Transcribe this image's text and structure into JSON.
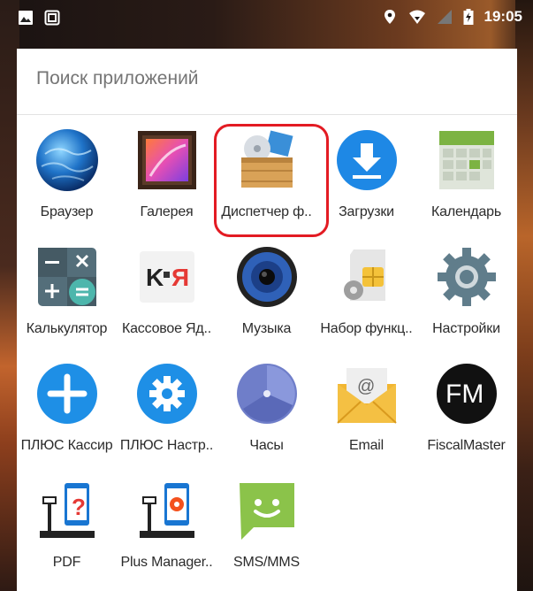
{
  "status_bar": {
    "time": "19:05",
    "left_icons": [
      "image-icon",
      "screenshot-icon"
    ],
    "right_icons": [
      "location-icon",
      "wifi-icon",
      "signal-icon",
      "battery-icon"
    ]
  },
  "search": {
    "placeholder": "Поиск приложений"
  },
  "apps": [
    [
      {
        "label": "Браузер",
        "icon": "globe-icon"
      },
      {
        "label": "Галерея",
        "icon": "gallery-icon"
      },
      {
        "label": "Диспетчер ф..",
        "icon": "file-manager-icon",
        "highlighted": true
      },
      {
        "label": "Загрузки",
        "icon": "download-icon"
      },
      {
        "label": "Календарь",
        "icon": "calendar-icon"
      }
    ],
    [
      {
        "label": "Калькулятор",
        "icon": "calculator-icon"
      },
      {
        "label": "Кассовое Яд..",
        "icon": "kassa-core-icon"
      },
      {
        "label": "Музыка",
        "icon": "speaker-icon"
      },
      {
        "label": "Набор функц..",
        "icon": "sim-toolkit-icon"
      },
      {
        "label": "Настройки",
        "icon": "settings-gear-icon"
      }
    ],
    [
      {
        "label": "ПЛЮС Кассир",
        "icon": "plus-cashier-icon"
      },
      {
        "label": "ПЛЮС Настр..",
        "icon": "plus-settings-icon"
      },
      {
        "label": "Часы",
        "icon": "clock-icon"
      },
      {
        "label": "Email",
        "icon": "email-icon"
      },
      {
        "label": "FiscalMaster",
        "icon": "fiscalmaster-icon"
      }
    ],
    [
      {
        "label": "PDF",
        "icon": "pdf-pos-icon"
      },
      {
        "label": "Plus Manager..",
        "icon": "plus-manager-icon"
      },
      {
        "label": "SMS/MMS",
        "icon": "sms-icon"
      }
    ]
  ],
  "colors": {
    "highlight": "#e31b23",
    "download_blue": "#1e88e5",
    "plus_blue": "#1e8fe6",
    "sms_green": "#8bc34a"
  }
}
